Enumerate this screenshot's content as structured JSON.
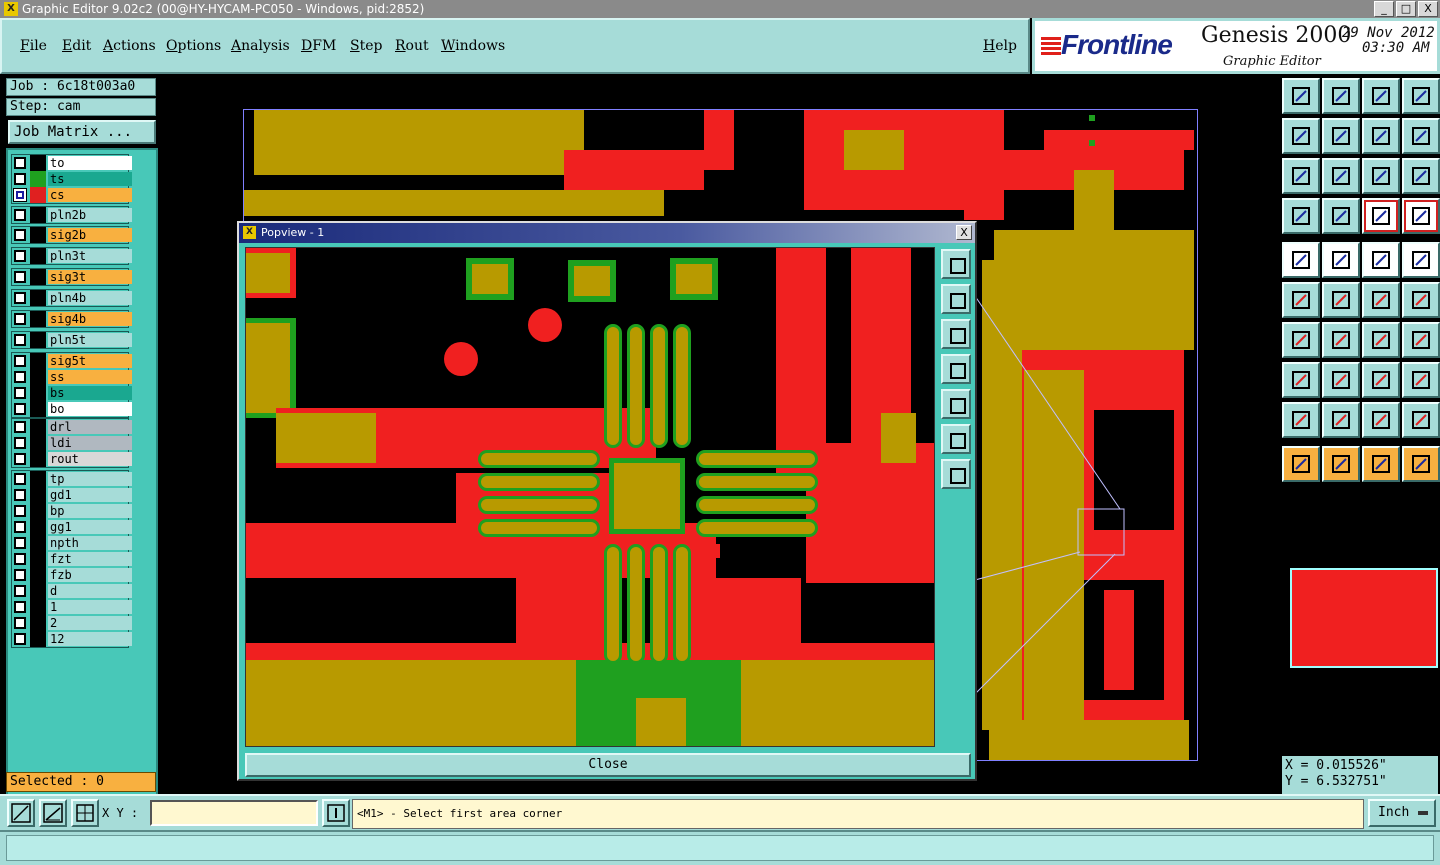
{
  "window": {
    "title": "Graphic Editor 9.02c2 (00@HY-HYCAM-PC050 - Windows, pid:2852)",
    "icon": "X",
    "buttons": [
      "_",
      "□",
      "X"
    ]
  },
  "menu": [
    "File",
    "Edit",
    "Actions",
    "Options",
    "Analysis",
    "DFM",
    "Step",
    "Rout",
    "Windows"
  ],
  "help": "Help",
  "brand": {
    "logo": "Frontline",
    "product": "Genesis 2000",
    "subtitle": "Graphic Editor",
    "date": "29 Nov 2012",
    "time": "03:30 AM"
  },
  "job": {
    "job_label": "Job : 6c18t003a0",
    "step_label": "Step: cam",
    "matrix_button": "Job Matrix ..."
  },
  "layer_groups": [
    {
      "layers": [
        {
          "name": "to",
          "color": "#000000",
          "bg": "#ffffff",
          "on": false
        },
        {
          "name": "ts",
          "color": "#1fa01f",
          "bg": "#1aa890",
          "on": false
        },
        {
          "name": "cs",
          "color": "#e02020",
          "bg": "#f8b040",
          "on": true
        }
      ]
    },
    {
      "layers": [
        {
          "name": "pln2b",
          "color": "#000000",
          "bg": "#a6dcd8",
          "on": false
        }
      ]
    },
    {
      "layers": [
        {
          "name": "sig2b",
          "color": "#000000",
          "bg": "#f8b040",
          "on": false
        }
      ]
    },
    {
      "layers": [
        {
          "name": "pln3t",
          "color": "#000000",
          "bg": "#a6dcd8",
          "on": false
        }
      ]
    },
    {
      "layers": [
        {
          "name": "sig3t",
          "color": "#000000",
          "bg": "#f8b040",
          "on": false
        }
      ]
    },
    {
      "layers": [
        {
          "name": "pln4b",
          "color": "#000000",
          "bg": "#a6dcd8",
          "on": false
        }
      ]
    },
    {
      "layers": [
        {
          "name": "sig4b",
          "color": "#000000",
          "bg": "#f8b040",
          "on": false
        }
      ]
    },
    {
      "layers": [
        {
          "name": "pln5t",
          "color": "#000000",
          "bg": "#a6dcd8",
          "on": false
        }
      ]
    },
    {
      "layers": [
        {
          "name": "sig5t",
          "color": "#000000",
          "bg": "#f8b040",
          "on": false
        },
        {
          "name": "ss",
          "color": "#000000",
          "bg": "#f8b040",
          "on": false
        },
        {
          "name": "bs",
          "color": "#000000",
          "bg": "#1aa890",
          "on": false
        },
        {
          "name": "bo",
          "color": "#000000",
          "bg": "#ffffff",
          "on": false
        }
      ]
    },
    {
      "layers": [
        {
          "name": "drl",
          "color": "#000000",
          "bg": "#b0b8c0",
          "on": false
        },
        {
          "name": "ldi",
          "color": "#000000",
          "bg": "#b0b8c0",
          "on": false
        },
        {
          "name": "rout",
          "color": "#000000",
          "bg": "#d8d8d8",
          "on": false
        }
      ]
    },
    {
      "layers": [
        {
          "name": "tp",
          "color": "#000000",
          "bg": "#a6dcd8",
          "on": false
        },
        {
          "name": "gd1",
          "color": "#000000",
          "bg": "#a6dcd8",
          "on": false
        },
        {
          "name": "bp",
          "color": "#000000",
          "bg": "#a6dcd8",
          "on": false
        },
        {
          "name": "gg1",
          "color": "#000000",
          "bg": "#a6dcd8",
          "on": false
        },
        {
          "name": "npth",
          "color": "#000000",
          "bg": "#a6dcd8",
          "on": false
        },
        {
          "name": "fzt",
          "color": "#000000",
          "bg": "#a6dcd8",
          "on": false
        },
        {
          "name": "fzb",
          "color": "#000000",
          "bg": "#a6dcd8",
          "on": false
        },
        {
          "name": "d",
          "color": "#000000",
          "bg": "#a6dcd8",
          "on": false
        },
        {
          "name": "1",
          "color": "#000000",
          "bg": "#a6dcd8",
          "on": false
        },
        {
          "name": "2",
          "color": "#000000",
          "bg": "#a6dcd8",
          "on": false
        },
        {
          "name": "12",
          "color": "#000000",
          "bg": "#a6dcd8",
          "on": false
        }
      ]
    }
  ],
  "selected": "Selected : 0",
  "popview": {
    "title": "Popview - 1",
    "close_label": "Close",
    "tools": [
      "zoom-fit-icon",
      "pan-up-icon",
      "pan-down-icon",
      "pan-left-icon",
      "pan-right-icon",
      "zoom-in-icon",
      "zoom-out-icon"
    ]
  },
  "coords": {
    "x": "X = 0.015526\"",
    "y": "Y = 6.532751\""
  },
  "status": {
    "xy_label": "X Y :",
    "xy_value": "",
    "message": "<M1> - Select first area corner",
    "unit": "Inch"
  },
  "colors": {
    "panel": "#a6dcd8",
    "copper": "#b89a00",
    "top_layer": "#f02020",
    "solder_mask": "#1fa01f",
    "highlight": "#f8b040"
  }
}
